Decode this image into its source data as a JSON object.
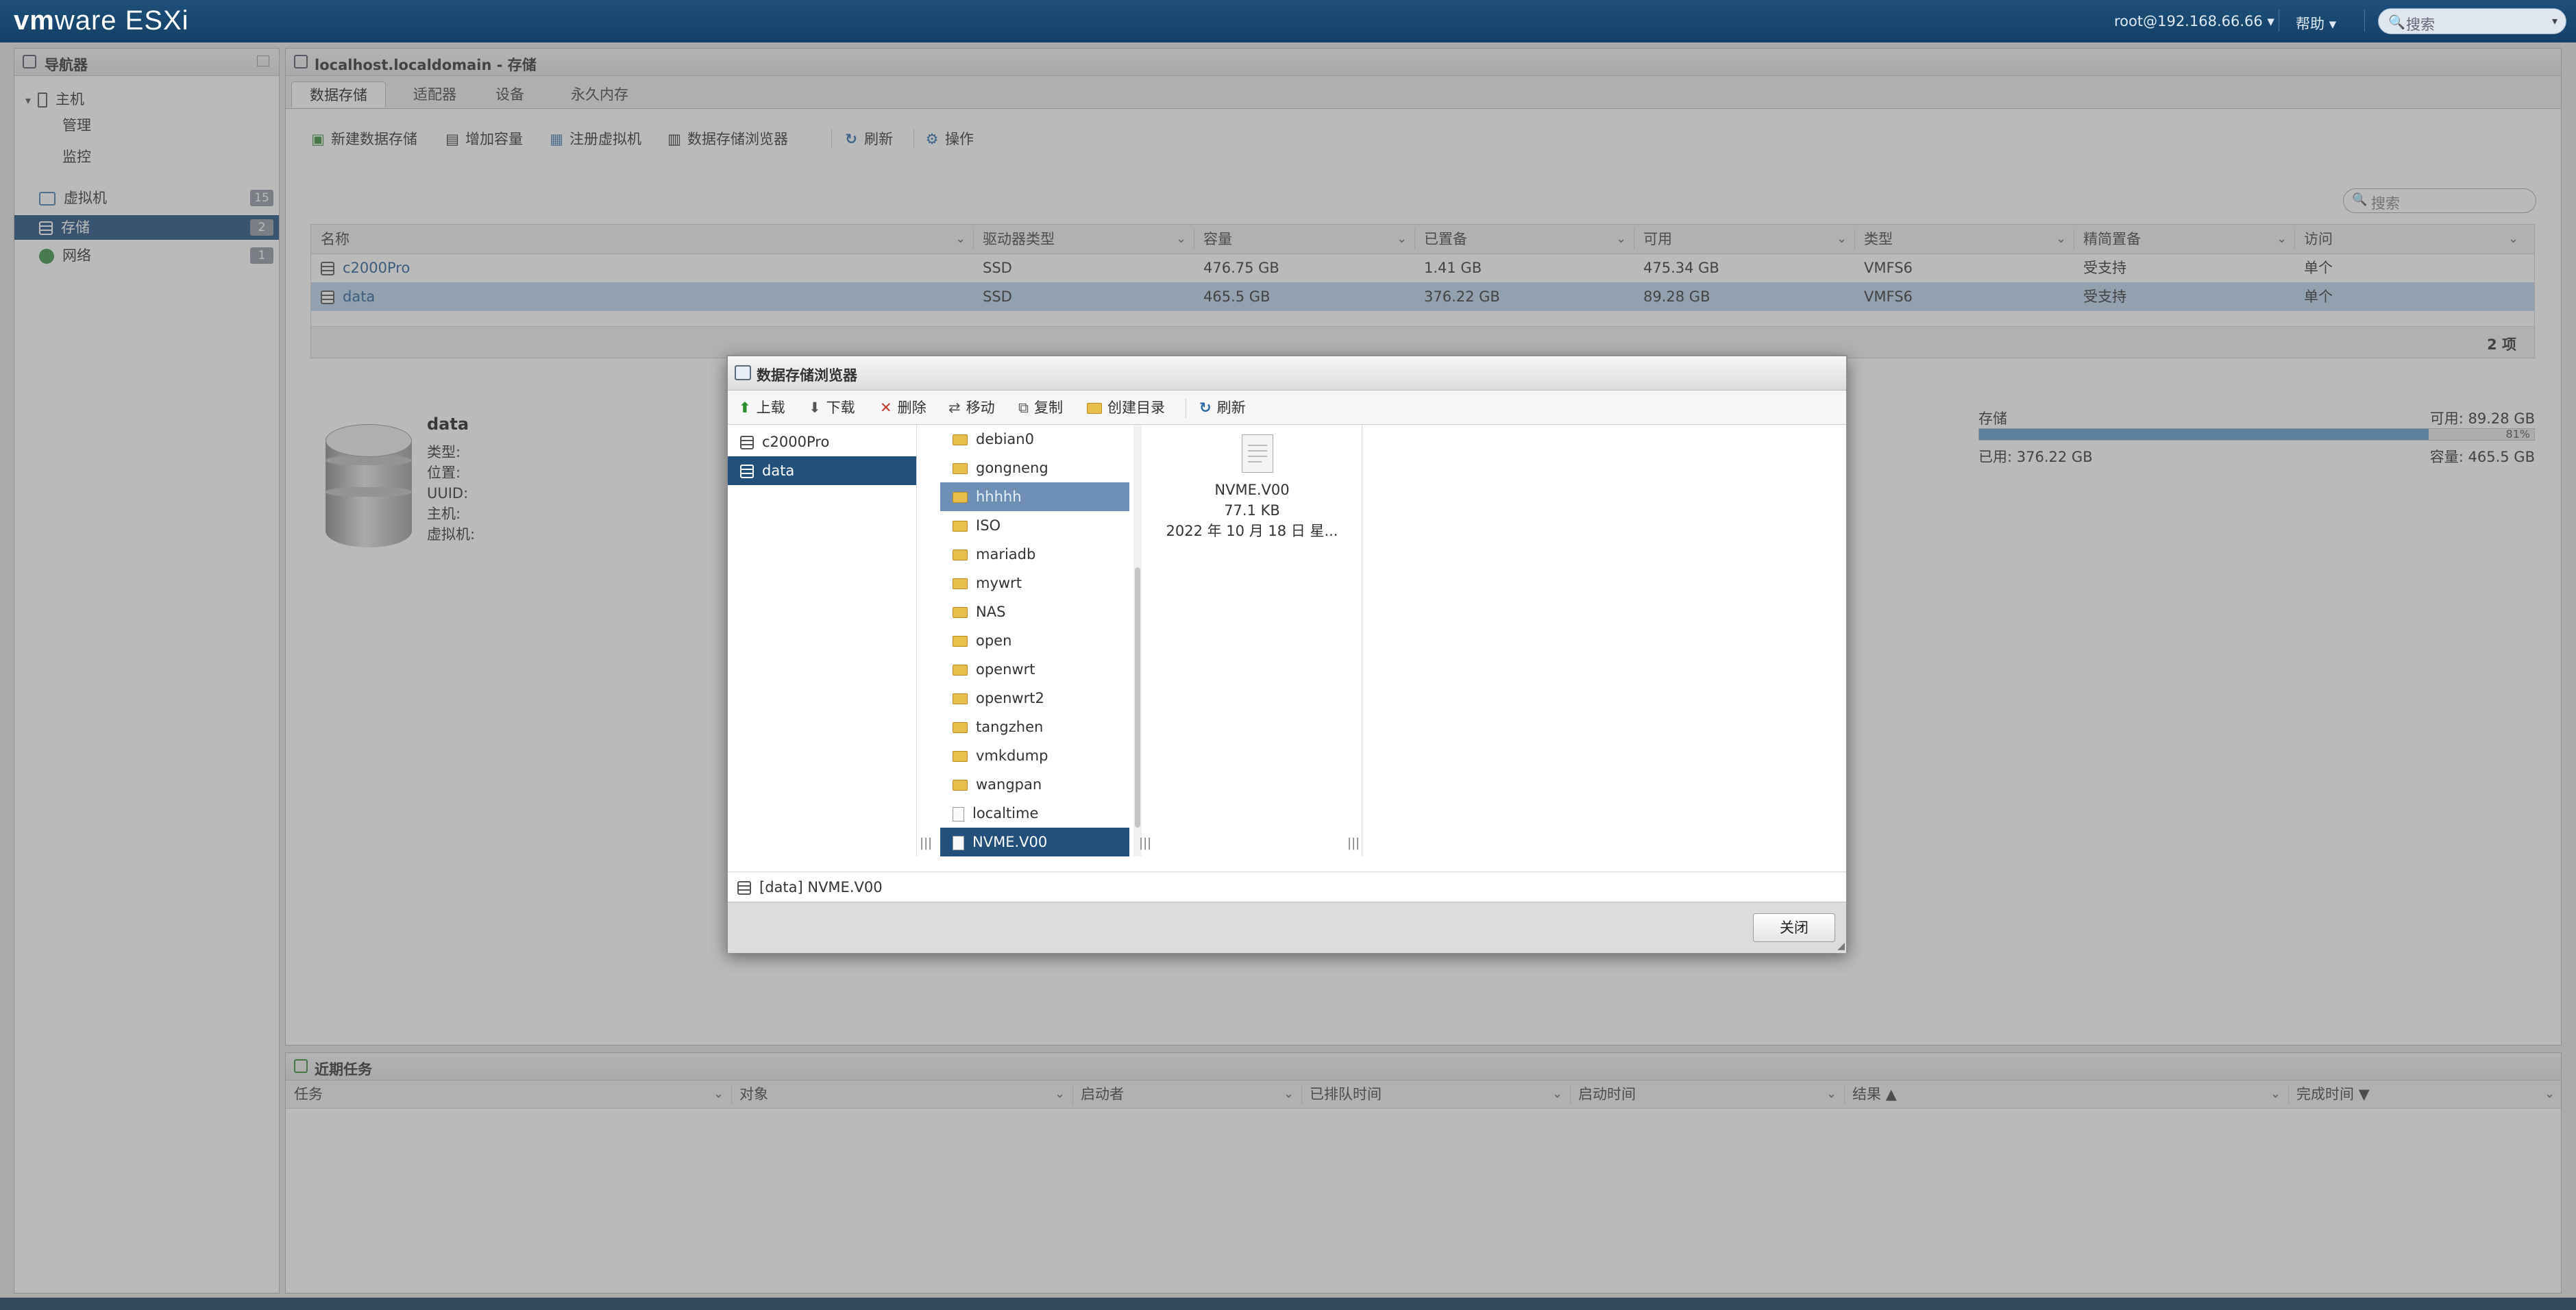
{
  "topbar": {
    "brand_vm": "vm",
    "brand_ware": "ware",
    "product": "ESXi",
    "user": "root@192.168.66.66 ▾",
    "help": "帮助 ▾",
    "search_placeholder": "搜索"
  },
  "navigator": {
    "title": "导航器",
    "host": "主机",
    "manage": "管理",
    "monitor": "监控",
    "vms": "虚拟机",
    "vms_count": "15",
    "storage": "存储",
    "storage_count": "2",
    "network": "网络",
    "network_count": "1"
  },
  "main": {
    "title": "localhost.localdomain - 存储",
    "tabs": [
      "数据存储",
      "适配器",
      "设备",
      "永久内存"
    ],
    "toolbar": {
      "new_datastore": "新建数据存储",
      "increase_capacity": "增加容量",
      "register_vm": "注册虚拟机",
      "datastore_browser": "数据存储浏览器",
      "refresh": "刷新",
      "actions": "操作"
    },
    "filter_placeholder": "搜索",
    "columns": [
      "名称",
      "驱动器类型",
      "容量",
      "已置备",
      "可用",
      "类型",
      "精简置备",
      "访问"
    ],
    "rows": [
      [
        "c2000Pro",
        "SSD",
        "476.75 GB",
        "1.41 GB",
        "475.34 GB",
        "VMFS6",
        "受支持",
        "单个"
      ],
      [
        "data",
        "SSD",
        "465.5 GB",
        "376.22 GB",
        "89.28 GB",
        "VMFS6",
        "受支持",
        "单个"
      ]
    ],
    "item_count": "2 项"
  },
  "detail": {
    "name": "data",
    "labels": [
      "类型:",
      "位置:",
      "UUID:",
      "主机:",
      "虚拟机:"
    ],
    "storage_label": "存储",
    "free": "可用: 89.28 GB",
    "percent": "81%",
    "used": "已用: 376.22 GB",
    "capacity": "容量: 465.5 GB",
    "usage_fraction": 0.81
  },
  "tasks": {
    "title": "近期任务",
    "columns": [
      "任务",
      "对象",
      "启动者",
      "已排队时间",
      "启动时间",
      "结果 ▲",
      "完成时间 ▼"
    ]
  },
  "dialog": {
    "title": "数据存储浏览器",
    "toolbar": {
      "upload": "上载",
      "download": "下载",
      "delete": "删除",
      "move": "移动",
      "copy": "复制",
      "mkdir": "创建目录",
      "refresh": "刷新"
    },
    "datastores": [
      "c2000Pro",
      "data"
    ],
    "folders": [
      "debian0",
      "gongneng",
      "hhhhh",
      "ISO",
      "mariadb",
      "mywrt",
      "NAS",
      "open",
      "openwrt",
      "openwrt2",
      "tangzhen",
      "vmkdump",
      "wangpan"
    ],
    "files": [
      "localtime",
      "NVME.V00"
    ],
    "preview": {
      "name": "NVME.V00",
      "size": "77.1 KB",
      "date": "2022 年 10 月 18 日 星..."
    },
    "path": "[data] NVME.V00",
    "close": "关闭"
  }
}
